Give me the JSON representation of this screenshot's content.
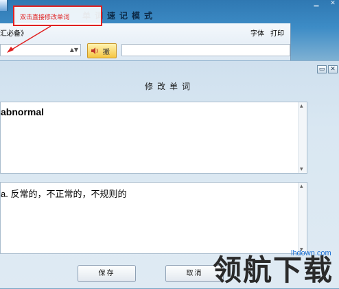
{
  "background_window": {
    "title": "单词速记模式",
    "breadcrumb": "汇必备》",
    "menu": {
      "font": "字体",
      "print": "打印"
    },
    "speaker_label": "搬"
  },
  "annotation": {
    "text": "双击直接修改单词",
    "color": "#e02020"
  },
  "dialog": {
    "title": "修改单词",
    "word_value": "abnormal",
    "meaning_value": "a. 反常的，不正常的，不规则的",
    "save_label": "保存",
    "cancel_label": "取消"
  },
  "watermark": {
    "text": "领航下载",
    "domain": "lhdown.com"
  },
  "colors": {
    "accent": "#2f78b2",
    "annotation": "#e02020",
    "speaker": "#f5c542"
  }
}
